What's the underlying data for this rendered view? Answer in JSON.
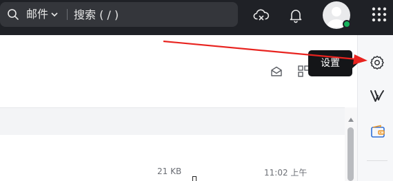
{
  "topbar": {
    "search": {
      "scope_label": "邮件",
      "placeholder": "搜索 ( / )",
      "icon": "search-icon",
      "scope_icon": "chevron-down-icon"
    },
    "icons": [
      "cloud-sync-icon",
      "bell-icon",
      "avatar",
      "apps-grid-icon"
    ],
    "status_color": "#16b35c"
  },
  "toolbar": {
    "icons": [
      "envelope-read-icon",
      "layout-grid-icon"
    ]
  },
  "list": {
    "row": {
      "size": "21 KB",
      "time": "11:02 上午"
    }
  },
  "right_rail": {
    "items": [
      "gear-icon",
      "v-logo-icon",
      "wallet-icon"
    ]
  },
  "tooltip": {
    "text": "设置"
  },
  "annotation": {
    "arrow_color": "#e8231f"
  }
}
